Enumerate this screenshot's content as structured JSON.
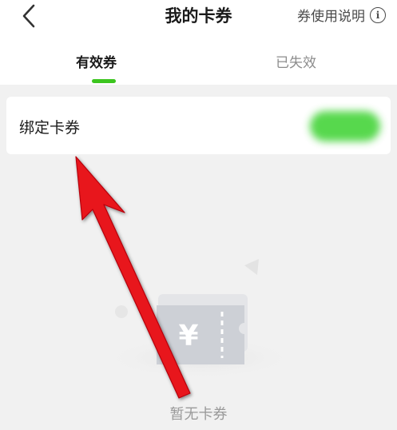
{
  "header": {
    "title": "我的卡券",
    "help_label": "券使用说明",
    "info_glyph": "i",
    "back_icon": "chevron-left-icon"
  },
  "tabs": [
    {
      "label": "有效券",
      "active": true
    },
    {
      "label": "已失效",
      "active": false
    }
  ],
  "bind_card": {
    "label": "绑定卡券"
  },
  "empty_state": {
    "text": "暂无卡券",
    "icon": "coupon-illustration",
    "currency_glyph": "¥"
  },
  "colors": {
    "accent": "#3cc51f",
    "arrow": "#e8131a",
    "background": "#f1f1f1"
  }
}
